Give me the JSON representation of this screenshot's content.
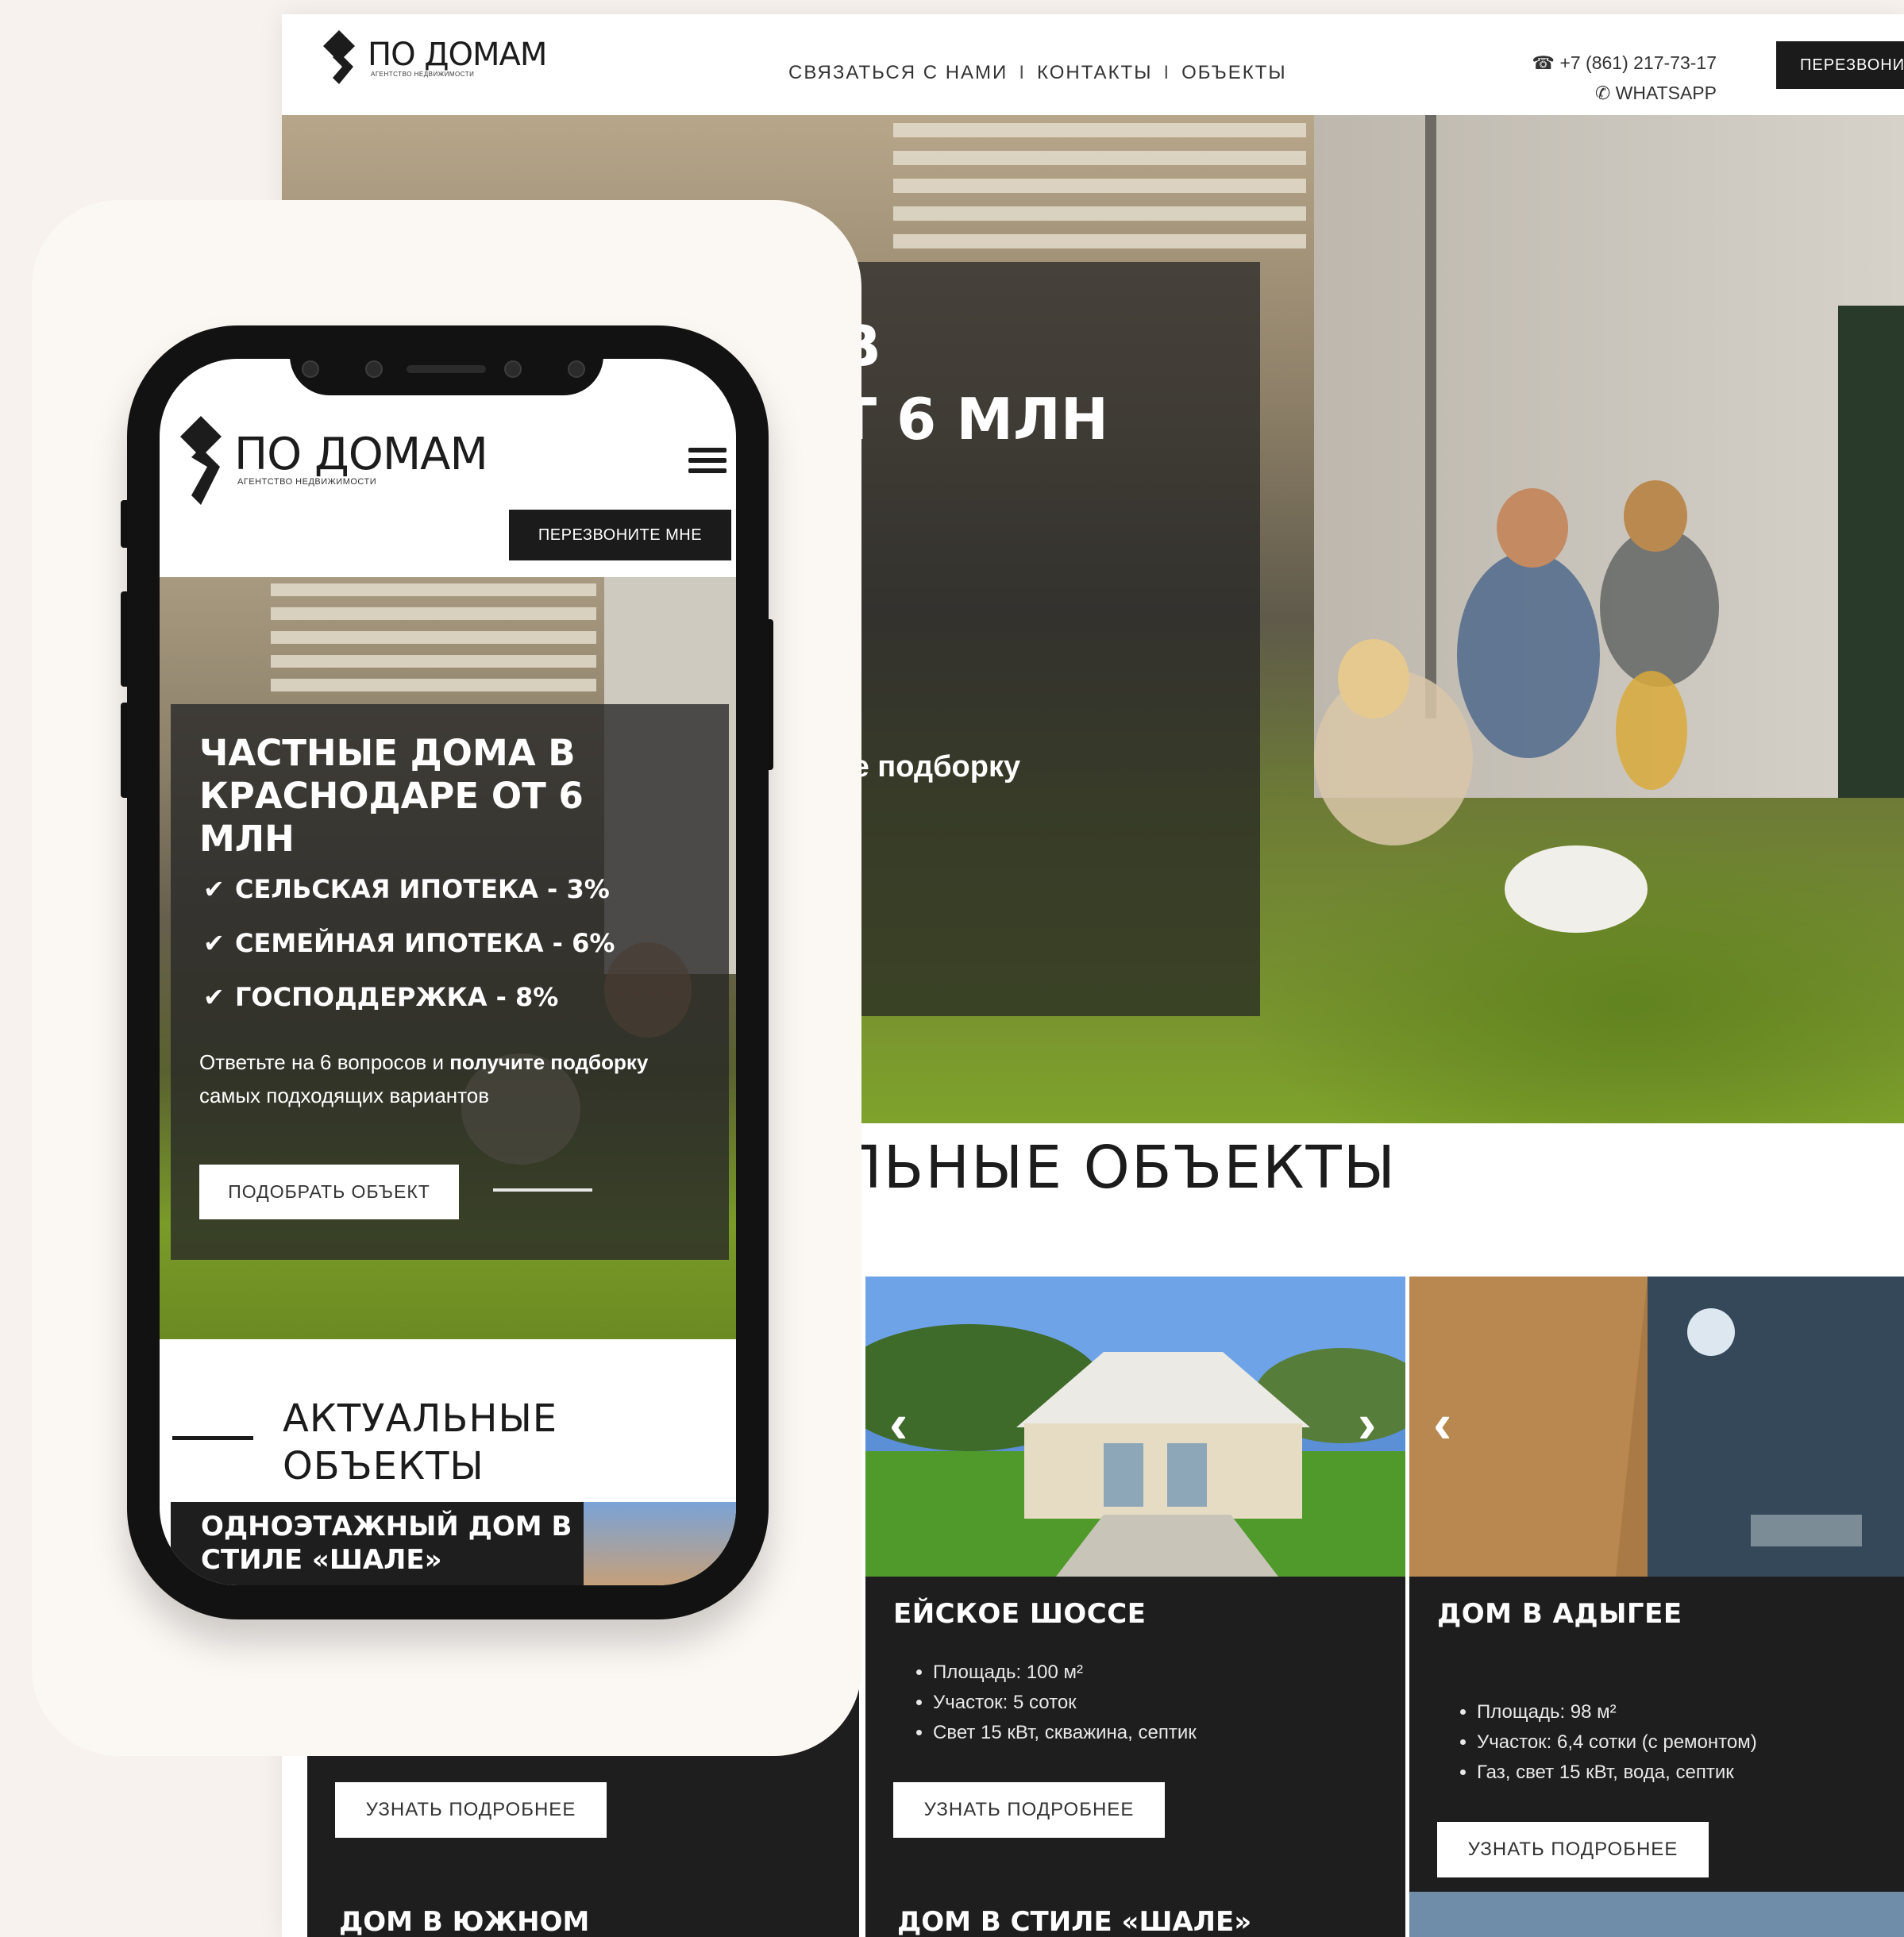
{
  "brand": {
    "name": "ПО ДОМАМ",
    "tagline_desktop": "АГЕНТСТВО НЕДВИЖИМОСТИ",
    "tagline_mobile": "АГЕНТСТВО НЕДВИЖИМОСТИ"
  },
  "desktop": {
    "nav": {
      "contact_us": "СВЯЗАТЬСЯ С НАМИ",
      "contacts": "КОНТАКТЫ",
      "objects": "ОБЪЕКТЫ",
      "separator": "I"
    },
    "phone": "+7 (861) 217-73-17",
    "whatsapp": "WHATSAPP",
    "call_button": "ПЕРЕЗВОНИТ",
    "hero_title_visible": "В\nТ 6 МЛН",
    "hero_cta_partial": "те подборку",
    "section_title_partial": "ЛЬНЫЕ ОБЪЕКТЫ",
    "cards": [
      {
        "title": "ЕЙСКОЕ ШОССЕ",
        "features": [
          "Площадь: 100 м²",
          "Участок: 5 соток",
          "Свет 15 кВт, скважина, септик"
        ],
        "button": "УЗНАТЬ ПОДРОБНЕЕ"
      },
      {
        "title": "ДОМ В АДЫГЕЕ",
        "features": [
          "Площадь: 98 м²",
          "Участок: 6,4 сотки (с ремонтом)",
          "Газ, свет 15 кВт, вода, септик"
        ],
        "button": "УЗНАТЬ ПОДРОБНЕЕ"
      }
    ],
    "hidden_card_button": "УЗНАТЬ ПОДРОБНЕЕ",
    "bottom_cards": [
      "ДОМ В ЮЖНОМ",
      "ДОМ В СТИЛЕ «ШАЛЕ»"
    ],
    "arrow_left": "‹",
    "arrow_right": "›"
  },
  "mobile": {
    "call_button": "ПЕРЕЗВОНИТЕ МНЕ",
    "hero_title": "ЧАСТНЫЕ ДОМА В КРАСНОДАРЕ ОТ 6 МЛН",
    "benefits": [
      "СЕЛЬСКАЯ ИПОТЕКА - 3%",
      "СЕМЕЙНАЯ ИПОТЕКА - 6%",
      "ГОСПОДДЕРЖКА - 8%"
    ],
    "desc_part1": "Ответьте на 6 вопросов и ",
    "desc_bold1": "получите подборку",
    "desc_part2": " самых подходящих вариантов",
    "pick_button": "ПОДОБРАТЬ ОБЪЕКТ",
    "section_title": "АКТУАЛЬНЫЕ ОБЪЕКТЫ",
    "card_title": "ОДНОЭТАЖНЫЙ ДОМ В СТИЛЕ «ШАЛЕ»"
  },
  "colors": {
    "dark": "#1b1b1b",
    "background": "#f7f2ee",
    "grass": "#7ea22b"
  },
  "icons": [
    "phone-icon",
    "whatsapp-icon",
    "hamburger-menu-icon",
    "check-icon",
    "arrow-left-icon",
    "arrow-right-icon"
  ]
}
